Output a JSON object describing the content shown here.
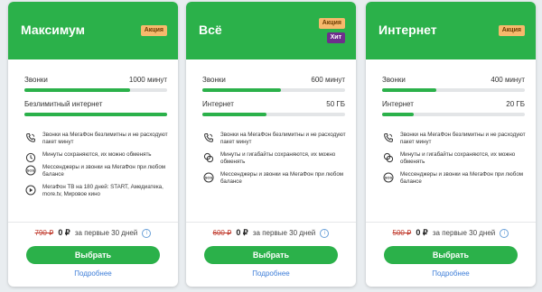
{
  "plans": [
    {
      "title": "Максимум",
      "badges": [
        "Акция"
      ],
      "calls_label": "Звонки",
      "calls_value": "1000 минут",
      "calls_fill": 0.74,
      "internet_label": "Безлимитный интернет",
      "internet_value": "",
      "internet_fill": 1.0,
      "features": [
        {
          "icon": "phone-icon",
          "text": "Звонки на МегаФон безлимитны и не расходуют пакет минут"
        },
        {
          "icon": "minutes-rollover-icon",
          "text": "Минуты сохраняются, их можно обменять"
        },
        {
          "icon": "sos-icon",
          "text": "Мессенджеры и звонки на МегаФон при любом балансе"
        },
        {
          "icon": "tv-icon",
          "text": "МегаФон ТВ на 180 дней: START, Амедиатека, more.tv, Мировое кино"
        }
      ],
      "old_price": "790 ₽",
      "new_price": "0 ₽",
      "price_note": "за первые 30 дней",
      "button": "Выбрать",
      "more": "Подробнее"
    },
    {
      "title": "Всё",
      "badges": [
        "Акция",
        "Хит"
      ],
      "calls_label": "Звонки",
      "calls_value": "600 минут",
      "calls_fill": 0.55,
      "internet_label": "Интернет",
      "internet_value": "50 ГБ",
      "internet_fill": 0.45,
      "features": [
        {
          "icon": "phone-icon",
          "text": "Звонки на МегаФон безлимитны и не расходуют пакет минут"
        },
        {
          "icon": "minutes-gigabytes-rollover-icon",
          "text": "Минуты и гигабайты сохраняются, их можно обменять"
        },
        {
          "icon": "sos-icon",
          "text": "Мессенджеры и звонки на МегаФон при любом балансе"
        }
      ],
      "old_price": "600 ₽",
      "new_price": "0 ₽",
      "price_note": "за первые 30 дней",
      "button": "Выбрать",
      "more": "Подробнее"
    },
    {
      "title": "Интернет",
      "badges": [
        "Акция"
      ],
      "calls_label": "Звонки",
      "calls_value": "400 минут",
      "calls_fill": 0.38,
      "internet_label": "Интернет",
      "internet_value": "20 ГБ",
      "internet_fill": 0.22,
      "features": [
        {
          "icon": "phone-icon",
          "text": "Звонки на МегаФон безлимитны и не расходуют пакет минут"
        },
        {
          "icon": "minutes-gigabytes-rollover-icon",
          "text": "Минуты и гигабайты сохраняются, их можно обменять"
        },
        {
          "icon": "sos-icon",
          "text": "Мессенджеры и звонки на МегаФон при любом балансе"
        }
      ],
      "old_price": "500 ₽",
      "new_price": "0 ₽",
      "price_note": "за первые 30 дней",
      "button": "Выбрать",
      "more": "Подробнее"
    }
  ],
  "colors": {
    "brand_green": "#2bb14a",
    "promo_badge": "#f7b96c",
    "hit_badge": "#6e2e8c",
    "old_price_red": "#c0392b",
    "link_blue": "#3d7dd8"
  }
}
